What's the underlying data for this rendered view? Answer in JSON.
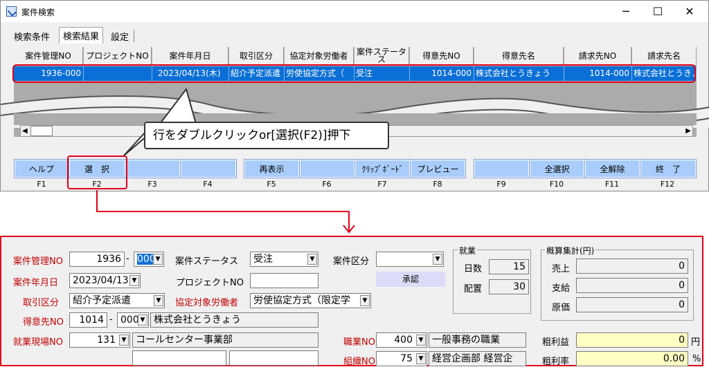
{
  "window": {
    "title": "案件検索",
    "minimize": "─",
    "maximize": "☐",
    "close": "✕"
  },
  "tabs": [
    {
      "label": "検索条件"
    },
    {
      "label": "検索結果"
    },
    {
      "label": "設定"
    }
  ],
  "grid": {
    "columns": [
      "案件管理NO",
      "プロジェクトNO",
      "案件年月日",
      "取引区分",
      "協定対象労働者",
      "案件ステータス",
      "得意先NO",
      "得意先名",
      "請求先NO",
      "請求先名"
    ],
    "row": [
      "1936-000",
      "",
      "2023/04/13(木)",
      "紹介予定派遣",
      "労使協定方式（",
      "受注",
      "1014-000",
      "株式会社とうきょう",
      "1014-000",
      "株式会社とうきょう"
    ]
  },
  "callout": {
    "text": "行をダブルクリックor[選択(F2)]押下"
  },
  "fkeys": [
    {
      "label": "ヘルプ",
      "key": "F1"
    },
    {
      "label": "選　択",
      "key": "F2"
    },
    {
      "label": "",
      "key": "F3"
    },
    {
      "label": "",
      "key": "F4"
    },
    {
      "label": "再表示",
      "key": "F5"
    },
    {
      "label": "",
      "key": "F6"
    },
    {
      "label": "ｸﾘｯﾌﾟﾎﾞｰﾄﾞ",
      "key": "F7"
    },
    {
      "label": "プレビュー",
      "key": "F8"
    },
    {
      "label": "",
      "key": "F9"
    },
    {
      "label": "全選択",
      "key": "F10"
    },
    {
      "label": "全解除",
      "key": "F11"
    },
    {
      "label": "終　了",
      "key": "F12"
    }
  ],
  "form": {
    "case_no_label": "案件管理NO",
    "case_no": "1936",
    "case_no_sep": "-",
    "case_no_sub": "000",
    "status_label": "案件ステータス",
    "status": "受注",
    "case_type_label": "案件区分",
    "case_type": "",
    "approve": "承認",
    "date_label": "案件年月日",
    "date": "2023/04/13",
    "project_label": "プロジェクトNO",
    "project": "",
    "trade_label": "取引区分",
    "trade": "紹介予定派遣",
    "labor_label": "協定対象労働者",
    "labor": "労使協定方式（限定学",
    "customer_label": "得意先NO",
    "customer_no": "1014",
    "customer_sep": "-",
    "customer_sub": "000",
    "customer_name": "株式会社とうきょう",
    "site_label": "就業現場NO",
    "site_no": "131",
    "site_name": "コールセンター事業部",
    "job_label": "職業NO",
    "job_no": "400",
    "job_name": "一般事務の職業",
    "org_label": "組織NO",
    "org_no": "75",
    "org_name": "経営企画部 経営企",
    "work_group": "就業",
    "days_label": "日数",
    "days": "15",
    "placement_label": "配置",
    "placement": "30",
    "summary_group": "概算集計(円)",
    "sales_label": "売上",
    "sales": "0",
    "pay_label": "支給",
    "pay": "0",
    "cost_label": "原価",
    "cost": "0",
    "gross_label": "粗利益",
    "gross": "0",
    "gross_unit": "円",
    "rate_label": "粗利率",
    "rate": "0.00",
    "rate_unit": "%"
  },
  "colors": {
    "accent_red": "#e0001b",
    "selection": "#0a6fd6",
    "fkey": "#a9cdfa"
  }
}
